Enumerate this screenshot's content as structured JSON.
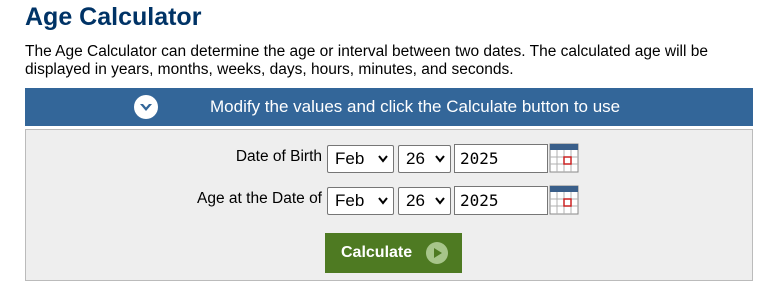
{
  "page": {
    "title": "Age Calculator",
    "description": "The Age Calculator can determine the age or interval between two dates. The calculated age will be displayed in years, months, weeks, days, hours, minutes, and seconds."
  },
  "banner": {
    "text": "Modify the values and click the Calculate button to use",
    "icon": "chevron-down-circle-icon"
  },
  "form": {
    "birth": {
      "label": "Date of Birth",
      "month": "Feb",
      "day": "26",
      "year": "2025"
    },
    "age_at": {
      "label": "Age at the Date of",
      "month": "Feb",
      "day": "26",
      "year": "2025"
    },
    "calculate_label": "Calculate"
  },
  "colors": {
    "title": "#003366",
    "banner": "#336699",
    "button": "#4e7a22",
    "panel": "#eeeeee"
  }
}
